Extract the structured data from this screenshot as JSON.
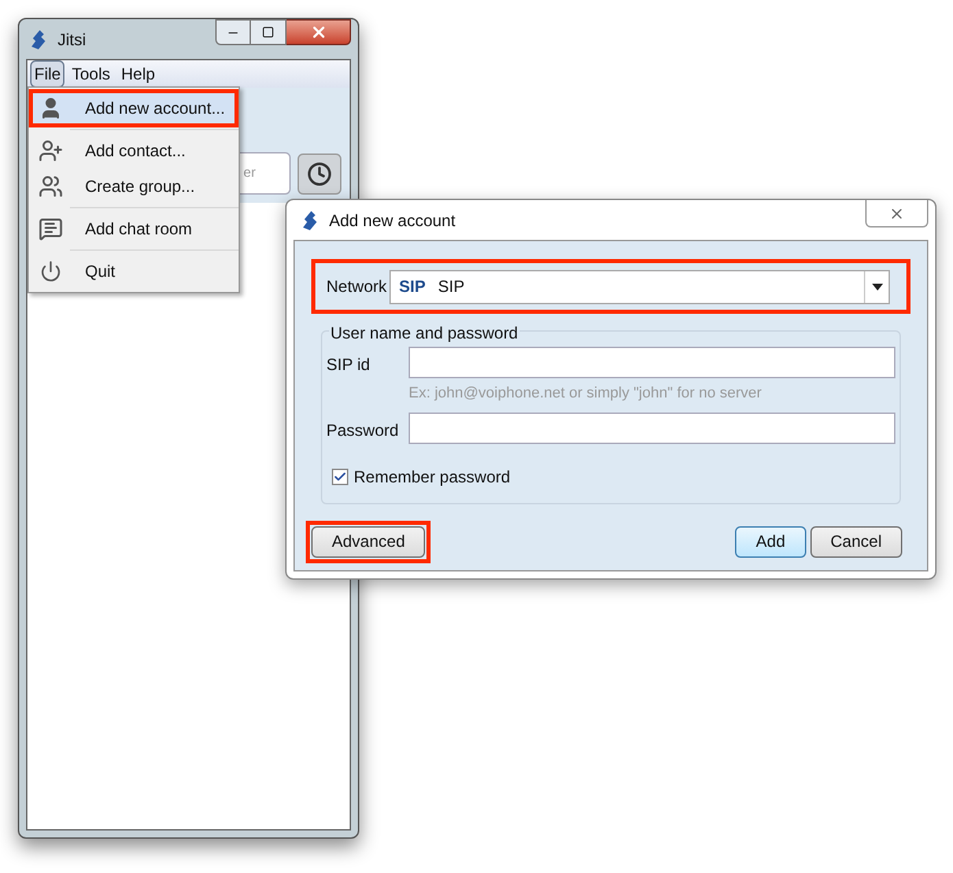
{
  "main_window": {
    "title": "Jitsi",
    "menu_bar": [
      {
        "label": "File",
        "selected": true
      },
      {
        "label": "Tools",
        "selected": false
      },
      {
        "label": "Help",
        "selected": false
      }
    ],
    "search": {
      "placeholder": "er"
    },
    "file_menu": {
      "groups": [
        [
          {
            "label": "Add new account...",
            "selected": true,
            "highlighted": true
          }
        ],
        [
          {
            "label": "Add contact...",
            "selected": false,
            "highlighted": false
          },
          {
            "label": "Create group...",
            "selected": false,
            "highlighted": false
          }
        ],
        [
          {
            "label": "Add chat room",
            "selected": false,
            "highlighted": false
          }
        ],
        [
          {
            "label": "Quit",
            "selected": false,
            "highlighted": false
          }
        ]
      ]
    }
  },
  "dialog": {
    "title": "Add new account",
    "network": {
      "label": "Network",
      "badge": "SIP",
      "value": "SIP",
      "highlighted": true
    },
    "group_title": "User name and password",
    "fields": [
      {
        "label": "SIP id",
        "hint": "Ex: john@voiphone.net or simply \"john\" for no server"
      },
      {
        "label": "Password"
      }
    ],
    "remember": {
      "label": "Remember password",
      "checked": true
    },
    "buttons": [
      {
        "label": "Advanced",
        "kind": "secondary",
        "highlighted": true
      },
      {
        "label": "Add",
        "kind": "default",
        "highlighted": false
      },
      {
        "label": "Cancel",
        "kind": "secondary",
        "highlighted": false
      }
    ]
  }
}
